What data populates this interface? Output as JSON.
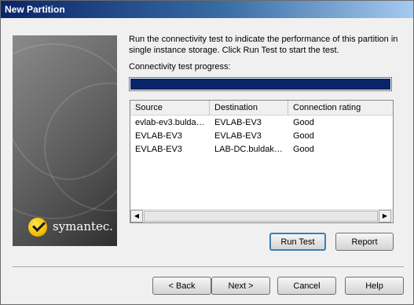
{
  "window": {
    "title": "New Partition"
  },
  "brand": {
    "logo_text": "symantec.",
    "logo_icon": "symantec-logo-icon"
  },
  "intro_text": "Run the connectivity test to indicate the performance of this partition in single instance storage.  Click Run Test to start the test.",
  "progress": {
    "label": "Connectivity test progress:",
    "value": 1.0
  },
  "table": {
    "columns": [
      "Source",
      "Destination",
      "Connection rating"
    ],
    "rows": [
      [
        "evlab-ev3.bulda…",
        "EVLAB-EV3",
        "Good"
      ],
      [
        "EVLAB-EV3",
        "EVLAB-EV3",
        "Good"
      ],
      [
        "EVLAB-EV3",
        "LAB-DC.buldak…",
        "Good"
      ]
    ]
  },
  "scrollbar": {
    "left_icon": "arrow-left-icon",
    "right_icon": "arrow-right-icon",
    "left_glyph": "◀",
    "right_glyph": "▶"
  },
  "buttons": {
    "run_test": "Run Test",
    "report": "Report",
    "back": "< Back",
    "next": "Next >",
    "cancel": "Cancel",
    "help": "Help"
  },
  "colors": {
    "titlebar": "#0a246a",
    "progress_fill": "#0a246a",
    "accent_border": "#3c7fb1"
  }
}
